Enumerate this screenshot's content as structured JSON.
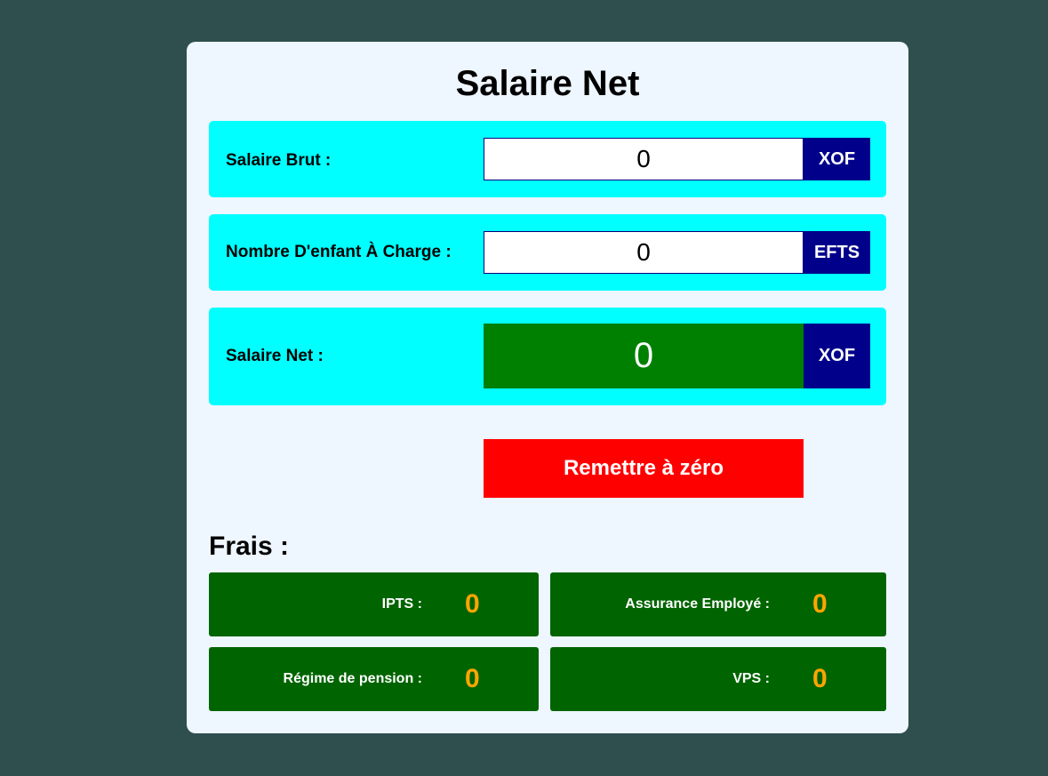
{
  "header": {
    "title": "Salaire Net"
  },
  "gross_salary": {
    "label": "Salaire Brut :",
    "value": "0",
    "unit": "XOF"
  },
  "children": {
    "label": "Nombre D'enfant À Charge :",
    "value": "0",
    "unit": "EFTS"
  },
  "net_salary": {
    "label": "Salaire Net :",
    "value": "0",
    "unit": "XOF"
  },
  "reset_button": {
    "label": "Remettre à zéro"
  },
  "fees": {
    "title": "Frais :",
    "items": [
      {
        "label": "IPTS :",
        "value": "0"
      },
      {
        "label": "Assurance Employé :",
        "value": "0"
      },
      {
        "label": "Régime de pension :",
        "value": "0"
      },
      {
        "label": "VPS :",
        "value": "0"
      }
    ]
  },
  "colors": {
    "background": "#2f4f4f",
    "card": "#eef6ff",
    "row": "#00ffff",
    "unit_badge": "#00008b",
    "net_output": "#008000",
    "reset": "#ff0000",
    "fee_box": "#006400",
    "fee_value": "#ffa500"
  }
}
